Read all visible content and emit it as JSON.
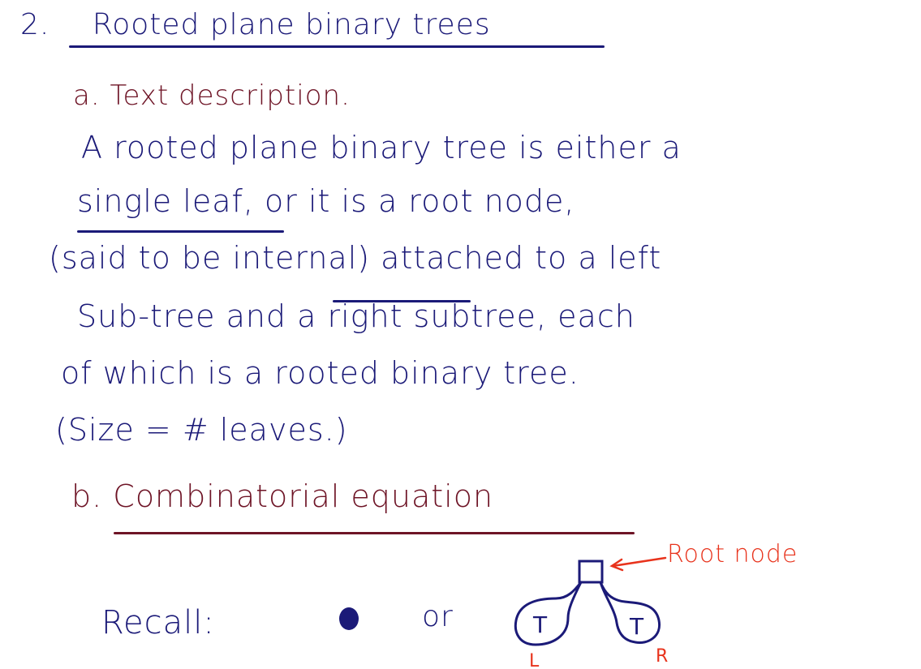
{
  "section": {
    "number": "2.",
    "title": "Rooted plane binary trees"
  },
  "part_a": {
    "heading": "a. Text description.",
    "lines": [
      "A rooted plane binary tree is either a",
      "single leaf, or it is a root node,",
      "(said to be internal) attached to a left",
      "Sub-tree and a right subtree, each",
      "of which is a rooted binary tree.",
      "(Size = # leaves.)"
    ]
  },
  "part_b": {
    "heading": "b. Combinatorial equation"
  },
  "recall": {
    "label": "Recall:",
    "or": "or",
    "root_node_label": "Root node",
    "left_subtree_letter": "T",
    "right_subtree_letter": "T",
    "left_mark": "L",
    "right_mark": "R"
  },
  "colors": {
    "ink_blue": "#1b1a78",
    "ink_maroon": "#6e1426",
    "ink_red": "#e8331c",
    "leaf_dot": "#1b1a78"
  }
}
